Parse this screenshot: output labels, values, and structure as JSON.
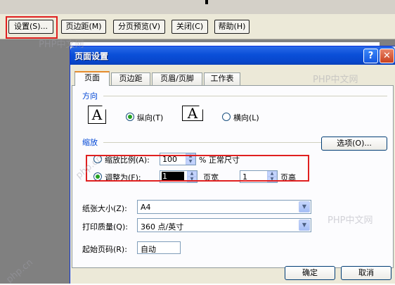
{
  "toolbar": {
    "setup": "设置(S)...",
    "margins": "页边距(M)",
    "page_break_preview": "分页预览(V)",
    "close": "关闭(C)",
    "help": "帮助(H)"
  },
  "dialog": {
    "title": "页面设置",
    "help_glyph": "?",
    "close_glyph": "✕",
    "tabs": [
      {
        "label": "页面"
      },
      {
        "label": "页边距"
      },
      {
        "label": "页眉/页脚"
      },
      {
        "label": "工作表"
      }
    ],
    "orientation": {
      "group_label": "方向",
      "portrait_label": "纵向(T)",
      "landscape_label": "横向(L)",
      "icon_glyph": "A",
      "selected": "portrait"
    },
    "scaling": {
      "group_label": "缩放",
      "adjust_label": "缩放比例(A):",
      "adjust_value": "100",
      "normal_size_label": "% 正常尺寸",
      "fit_label": "调整为(F):",
      "fit_wide_value": "1",
      "pages_wide_label": "页宽",
      "fit_tall_value": "1",
      "pages_tall_label": "页高",
      "selected": "fit"
    },
    "options_button": "选项(O)...",
    "paper_size_label": "纸张大小(Z):",
    "paper_size_value": "A4",
    "print_quality_label": "打印质量(Q):",
    "print_quality_value": "360 点/英寸",
    "first_page_label": "起始页码(R):",
    "first_page_value": "自动",
    "ok": "确定",
    "cancel": "取消"
  },
  "watermarks": [
    "PHP中文网",
    "php.cn"
  ]
}
